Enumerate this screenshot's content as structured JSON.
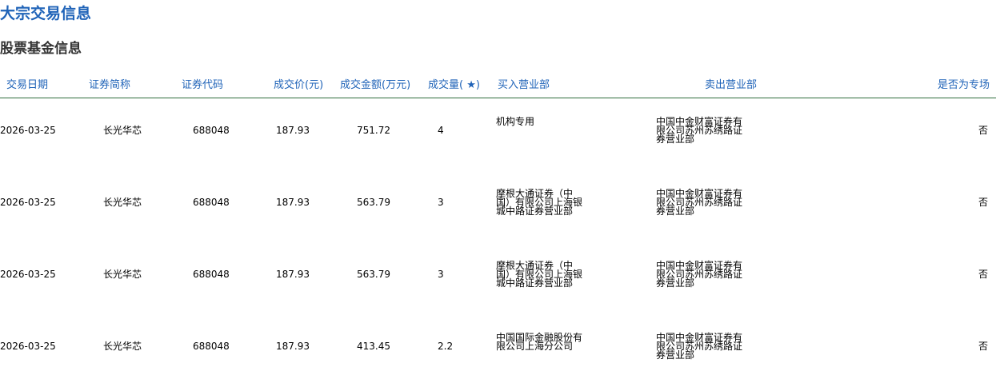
{
  "page": {
    "title": "大宗交易信息",
    "section_title": "股票基金信息"
  },
  "table": {
    "headers": {
      "date": "交易日期",
      "name": "证券简称",
      "code": "证券代码",
      "price": "成交价(元)",
      "amount": "成交金额(万元)",
      "volume": "成交量( ★)",
      "buyer": "买入营业部",
      "seller": "卖出营业部",
      "special": "是否为专场"
    },
    "rows": [
      {
        "date": "2026-03-25",
        "name": "长光华芯",
        "code": "688048",
        "price": "187.93",
        "amount": "751.72",
        "volume": "4",
        "buyer": "机构专用",
        "seller": "中国中金财富证券有限公司苏州苏绣路证券营业部",
        "special": "否"
      },
      {
        "date": "2026-03-25",
        "name": "长光华芯",
        "code": "688048",
        "price": "187.93",
        "amount": "563.79",
        "volume": "3",
        "buyer": "摩根大通证券（中国）有限公司上海银城中路证券营业部",
        "seller": "中国中金财富证券有限公司苏州苏绣路证券营业部",
        "special": "否"
      },
      {
        "date": "2026-03-25",
        "name": "长光华芯",
        "code": "688048",
        "price": "187.93",
        "amount": "563.79",
        "volume": "3",
        "buyer": "摩根大通证券（中国）有限公司上海银城中路证券营业部",
        "seller": "中国中金财富证券有限公司苏州苏绣路证券营业部",
        "special": "否"
      },
      {
        "date": "2026-03-25",
        "name": "长光华芯",
        "code": "688048",
        "price": "187.93",
        "amount": "413.45",
        "volume": "2.2",
        "buyer": "中国国际金融股份有限公司上海分公司",
        "seller": "中国中金财富证券有限公司苏州苏绣路证券营业部",
        "special": "否"
      }
    ]
  }
}
